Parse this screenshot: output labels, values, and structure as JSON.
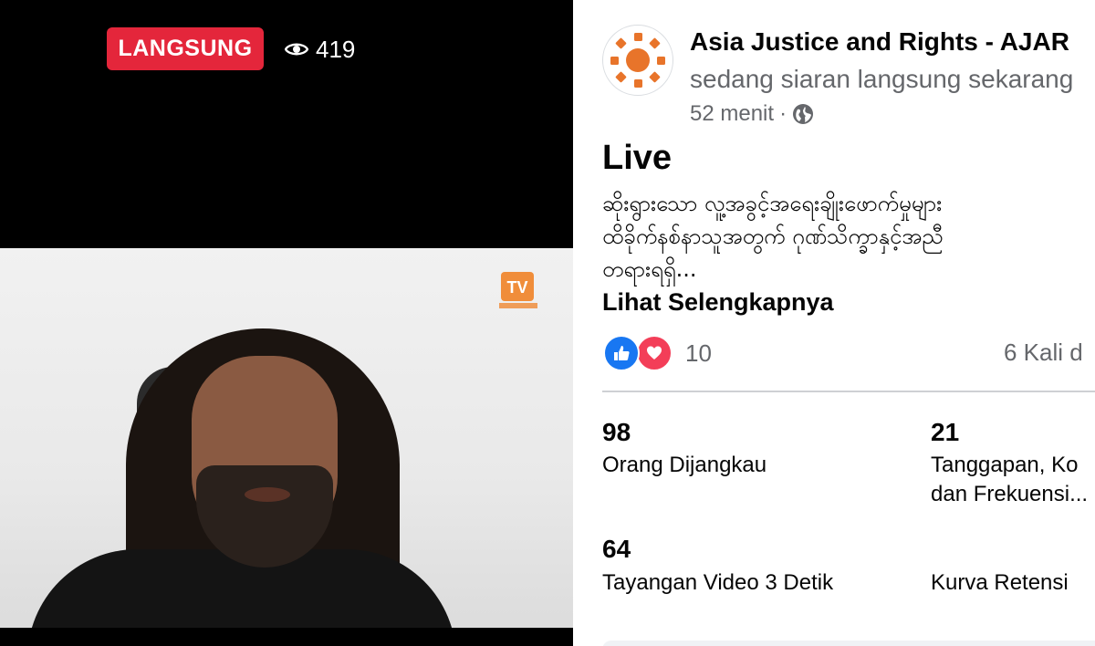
{
  "video": {
    "live_badge": "LANGSUNG",
    "viewer_count": "419",
    "channel_logo_text": "TV"
  },
  "post": {
    "page_name": "Asia Justice and Rights - AJAR",
    "subtitle": "sedang siaran langsung sekarang",
    "time": "52 menit",
    "separator": "·",
    "title": "Live",
    "text": "ဆိုးရွားသော လူ့အခွင့်အရေးချိုးဖောက်မှုများ\nထိခိုက်နစ်နာသူအတွက် ဂုဏ်သိက္ခာနှင့်အညီ\nတရားရရှိ...",
    "see_more": "Lihat Selengkapnya",
    "reaction_count": "10",
    "shares": "6 Kali d"
  },
  "stats": [
    {
      "value": "98",
      "label": "Orang Dijangkau"
    },
    {
      "value": "21",
      "label": "Tanggapan, Ko\ndan Frekuensi..."
    },
    {
      "value": "64",
      "label": "Tayangan Video 3 Detik"
    },
    {
      "value": "",
      "label": "Kurva Retensi"
    }
  ],
  "colors": {
    "live_red": "#e4263b",
    "like_blue": "#1877f2",
    "love_red": "#f33e58",
    "secondary_text": "#65676b",
    "avatar_orange": "#e8742a"
  }
}
